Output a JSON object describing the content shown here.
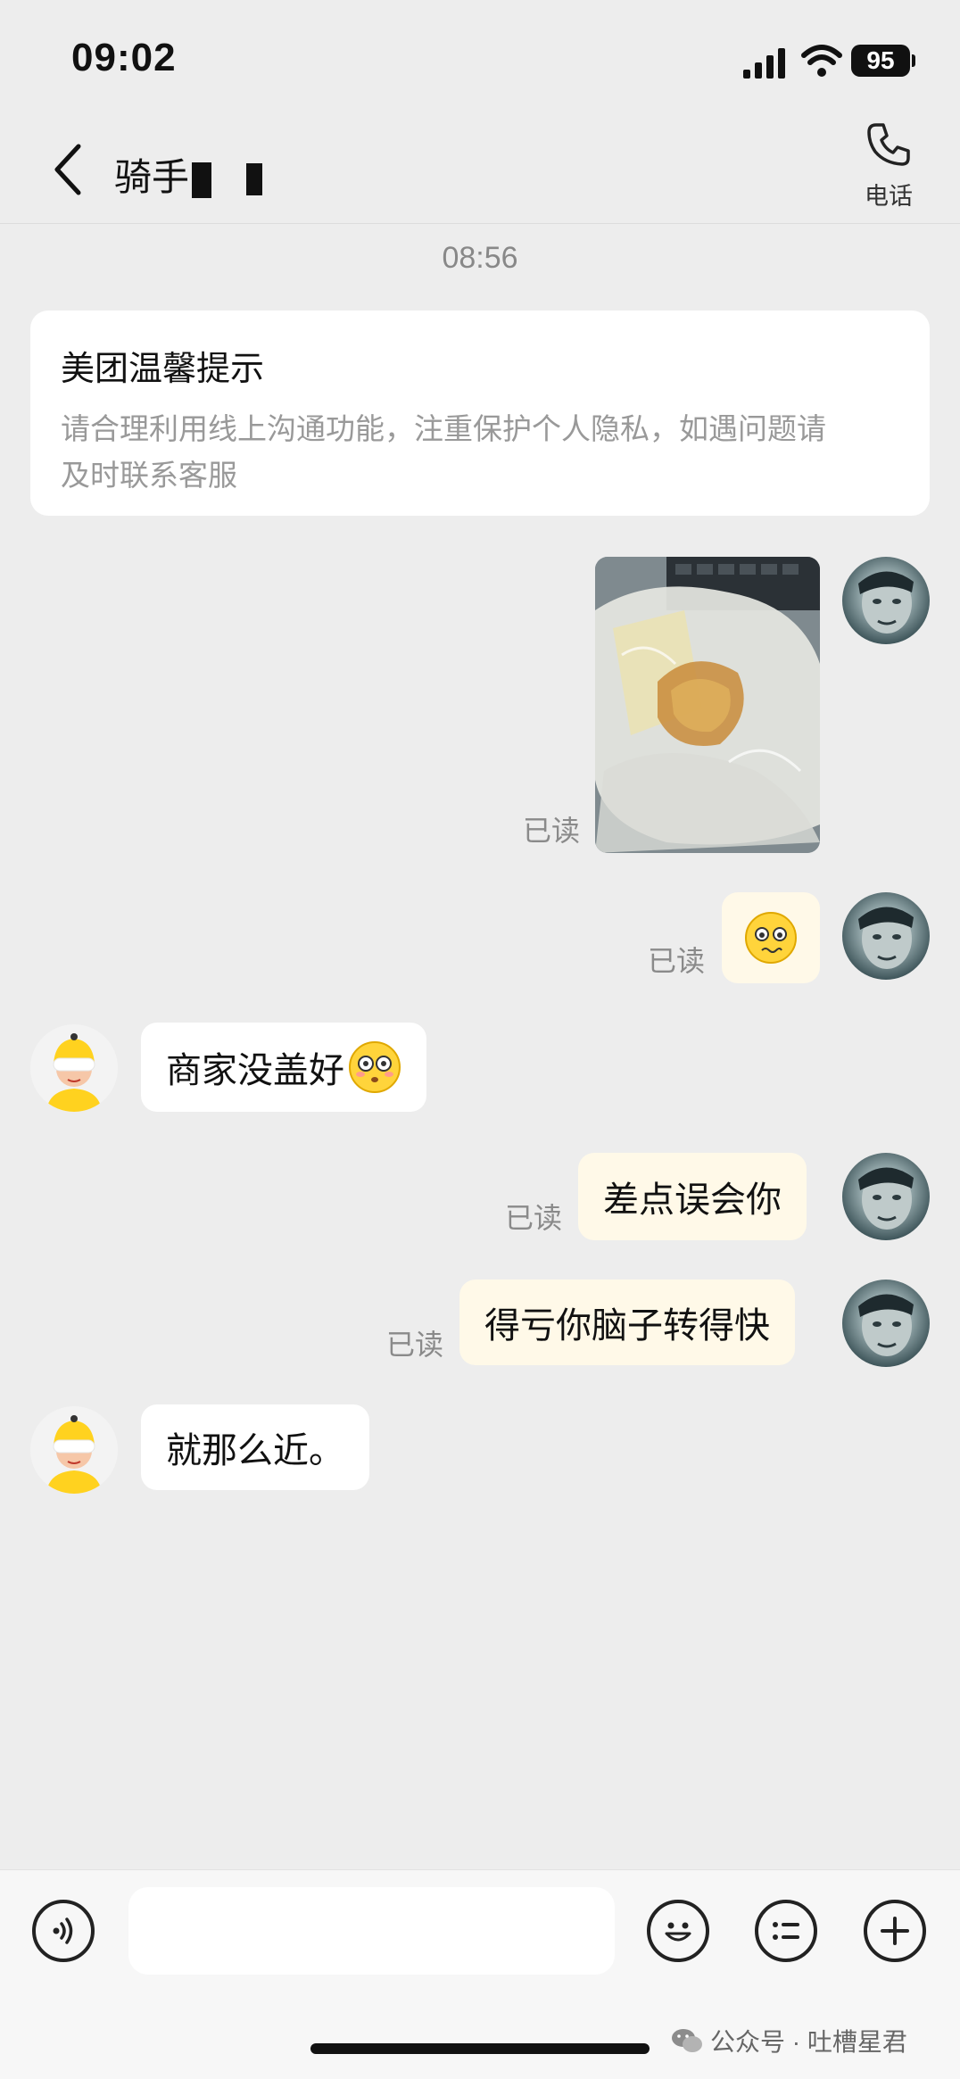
{
  "status_bar": {
    "time": "09:02",
    "battery": "95"
  },
  "header": {
    "title": "骑手",
    "phone_label": "电话"
  },
  "timestamp": "08:56",
  "tip": {
    "title": "美团温馨提示",
    "line1": "请合理利用线上沟通功能，注重保护个人隐私，如遇问题请",
    "line2": "及时联系客服"
  },
  "messages": {
    "m1_read": "已读",
    "m2_read": "已读",
    "m3_text": "商家没盖好",
    "m4_text": "差点误会你",
    "m4_read": "已读",
    "m5_text": "得亏你脑子转得快",
    "m5_read": "已读",
    "m6_text": "就那么近。"
  },
  "input": {
    "placeholder": ""
  },
  "watermark": "公众号 · 吐槽星君",
  "icons": {
    "back": "chevron-left-icon",
    "phone": "phone-icon",
    "voice": "voice-icon",
    "emoji": "emoji-icon",
    "quick_reply": "list-icon",
    "plus": "plus-icon"
  },
  "colors": {
    "self_bubble": "#fff9e8",
    "other_bubble": "#ffffff",
    "rider_yellow": "#ffd21f"
  }
}
